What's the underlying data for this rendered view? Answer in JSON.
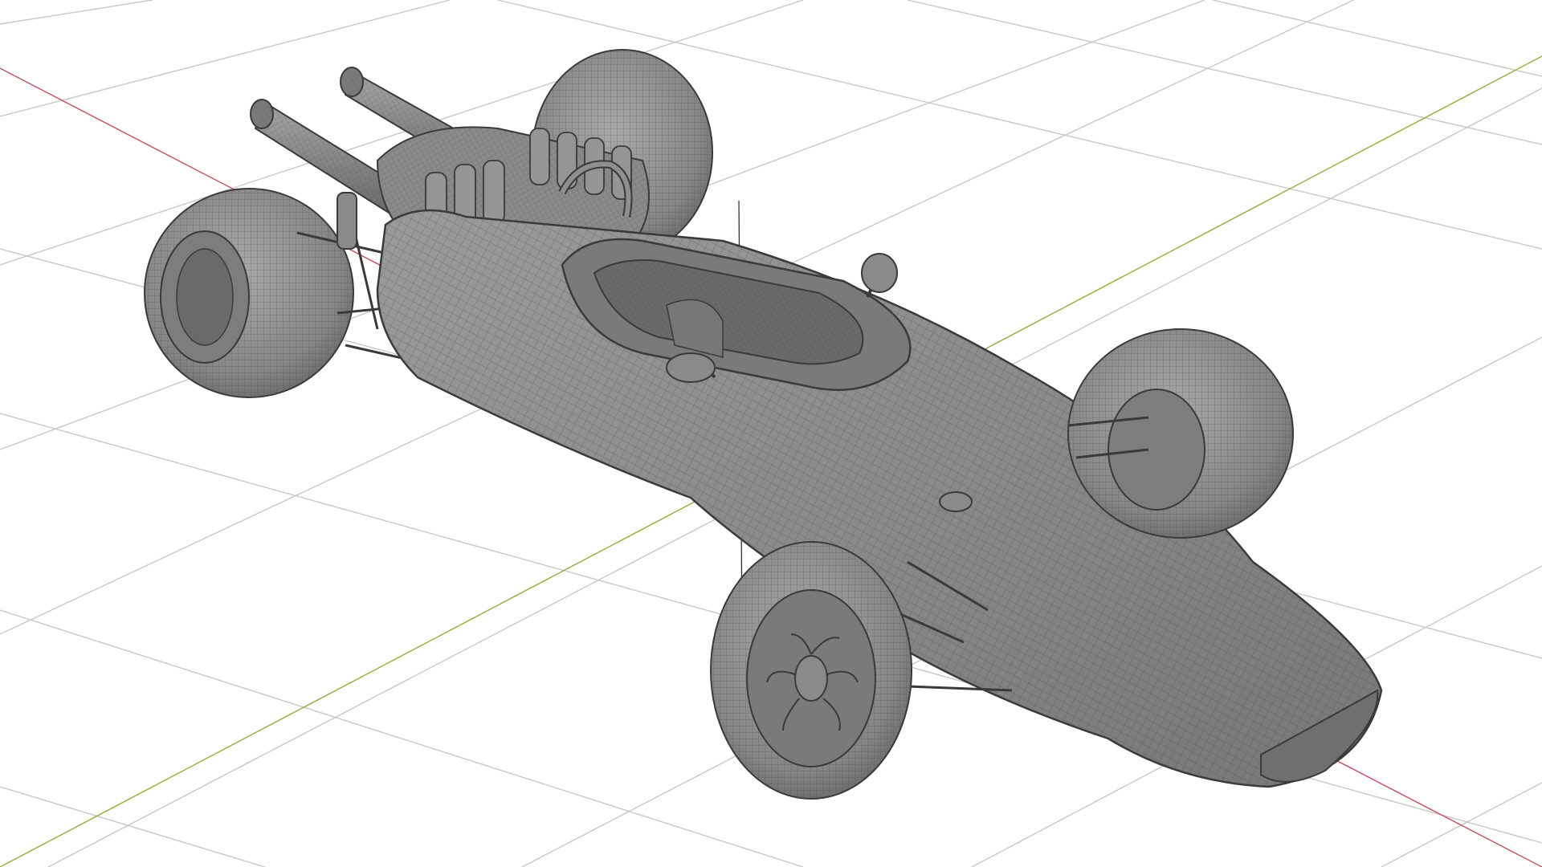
{
  "viewport": {
    "background": "#ffffff",
    "grid_color": "#c8c8c8",
    "x_axis_color": "#c0505c",
    "y_axis_color": "#9aa83a",
    "mesh_fill": "#8d8d8d",
    "mesh_dark": "#5e5e5e",
    "mesh_light": "#b4b4b4",
    "wire_color": "#3e3e3e"
  },
  "scene": {
    "object": "race-car-wireframe-mesh",
    "shading": "solid-with-wireframe"
  }
}
